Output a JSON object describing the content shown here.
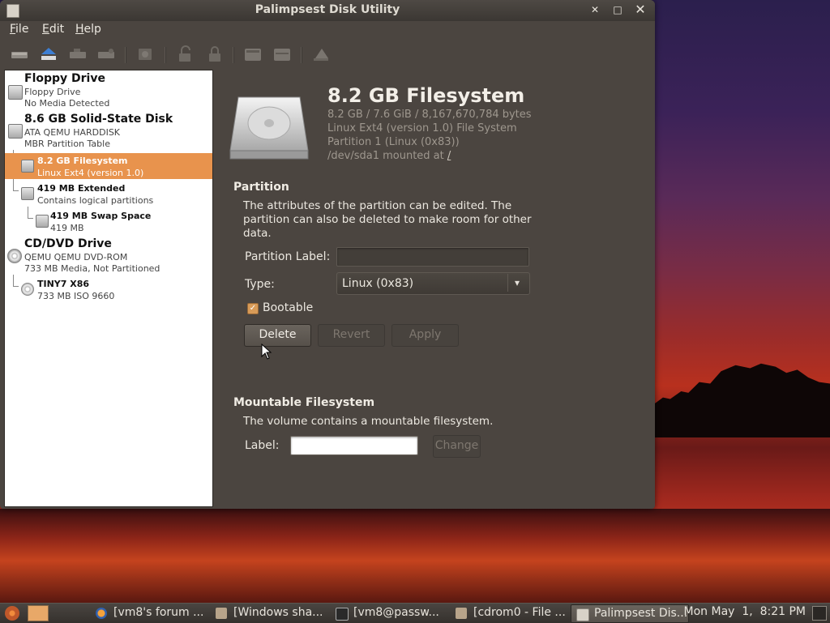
{
  "window": {
    "title": "Palimpsest Disk Utility",
    "controls": {
      "minimize": "✕",
      "maximize": "□",
      "close": "✕"
    }
  },
  "menu": [
    {
      "label": "File",
      "accel": "F",
      "rest": "ile"
    },
    {
      "label": "Edit",
      "accel": "E",
      "rest": "dit"
    },
    {
      "label": "Help",
      "accel": "H",
      "rest": "elp"
    }
  ],
  "toolbar": {
    "buttons": [
      "drive-icon",
      "eject-icon",
      "drive-detach-icon",
      "drive-smart-icon",
      "benchmark-icon",
      "unlock-icon",
      "lock-icon",
      "format-icon",
      "partition-icon",
      "erase-icon"
    ]
  },
  "tree": [
    {
      "title": "Floppy Drive",
      "subtitle": "Floppy Drive",
      "line3": "No Media Detected",
      "icon": "floppy-icon"
    },
    {
      "title": "8.6 GB Solid-State Disk",
      "subtitle": "ATA QEMU HARDDISK",
      "line3": "MBR Partition Table",
      "icon": "harddisk-icon"
    },
    {
      "title": "8.2 GB Filesystem",
      "subtitle": "Linux Ext4 (version 1.0)",
      "icon": "partition-icon",
      "selected": true
    },
    {
      "title": "419 MB Extended",
      "subtitle": "Contains logical partitions",
      "icon": "partition-icon"
    },
    {
      "title": "419 MB Swap Space",
      "subtitle": "419 MB",
      "icon": "partition-icon"
    },
    {
      "title": "CD/DVD Drive",
      "subtitle": "QEMU QEMU DVD-ROM",
      "line3": "733 MB Media, Not Partitioned",
      "icon": "cdrom-icon"
    },
    {
      "title": "TINY7 X86",
      "subtitle": "733 MB ISO 9660",
      "icon": "disc-icon"
    }
  ],
  "volume": {
    "title": "8.2 GB Filesystem",
    "size": "8.2 GB / 7.6 GiB / 8,167,670,784 bytes",
    "fs": "Linux Ext4 (version 1.0) File System",
    "partition": "Partition 1 (Linux (0x83))",
    "mount_prefix": "/dev/sda1 mounted at ",
    "mount_point": "/"
  },
  "partition": {
    "heading": "Partition",
    "description": "The attributes of the partition can be edited. The partition can also be deleted to make room for other data.",
    "label_caption": "Partition Label:",
    "label_value": "",
    "type_caption": "Type:",
    "type_value": "Linux (0x83)",
    "bootable_label": "Bootable",
    "bootable": true,
    "delete_label": "Delete",
    "revert_label": "Revert",
    "apply_label": "Apply"
  },
  "mountable": {
    "heading": "Mountable Filesystem",
    "description": "The volume contains a mountable filesystem.",
    "label_caption": "Label:",
    "label_value": "",
    "change_label": "Change"
  },
  "taskbar": {
    "tasks": [
      {
        "label": "[vm8's forum ...",
        "icon": "firefox-icon"
      },
      {
        "label": "[Windows sha...",
        "icon": "folder-icon"
      },
      {
        "label": "[vm8@passw...",
        "icon": "terminal-icon"
      },
      {
        "label": "[cdrom0 - File ...",
        "icon": "folder-icon"
      },
      {
        "label": "Palimpsest Dis...",
        "icon": "disk-utility-icon",
        "active": true
      }
    ],
    "clock": "Mon May  1,  8:21 PM"
  },
  "colors": {
    "selection": "#e8934d",
    "window_bg": "#4b4540",
    "accent": "#d89b58"
  }
}
